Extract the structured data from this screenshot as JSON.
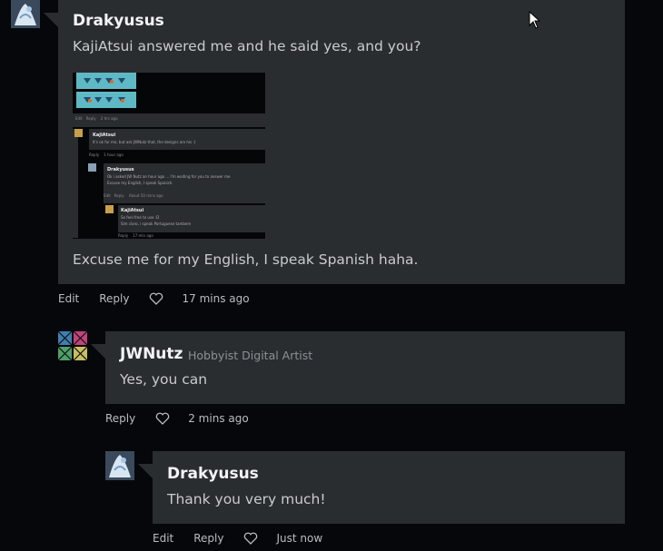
{
  "comments": [
    {
      "author": "Drakyusus",
      "text": "KajiAtsui answered me and he said yes, and you?",
      "text2": "Excuse me for my English, I speak Spanish haha.",
      "actions": {
        "edit": "Edit",
        "reply": "Reply",
        "time": "17 mins ago"
      },
      "embedded": {
        "c1_author": "KajiAtsui",
        "c1_text": "It's ok for me, but ask JWNutz that, the designs are his :)",
        "c1_reply": "Reply",
        "c1_time": "1 hour ago",
        "c2_author": "Drakyusus",
        "c2_text1": "Ok i asked JW Nutz an hour ago ... I'm waiting for you to answer me",
        "c2_text2": "Excuse my English, I speak Spanish.",
        "c2_edit": "Edit",
        "c2_reply": "Reply",
        "c2_time": "About 50 mins ago",
        "c3_author": "KajiAtsui",
        "c3_text1": "So feel free to use :D",
        "c3_text2": "Sim claro, i speak Portuguese tambem",
        "c3_reply": "Reply",
        "c3_time": "17 min ago",
        "top_edit": "Edit",
        "top_reply": "Reply",
        "top_time": "2 hrs ago"
      }
    },
    {
      "author": "JWNutz",
      "role": "Hobbyist Digital Artist",
      "text": "Yes, you can",
      "actions": {
        "reply": "Reply",
        "time": "2 mins ago"
      }
    },
    {
      "author": "Drakyusus",
      "text": "Thank you very much!",
      "actions": {
        "edit": "Edit",
        "reply": "Reply",
        "time": "Just now"
      }
    }
  ],
  "colors": {
    "background": "#06070a",
    "bubble": "#2a2d30",
    "text": "#c9cbcd"
  },
  "icons": [
    "heart-icon",
    "mouse-cursor-icon",
    "avatar-icon"
  ]
}
